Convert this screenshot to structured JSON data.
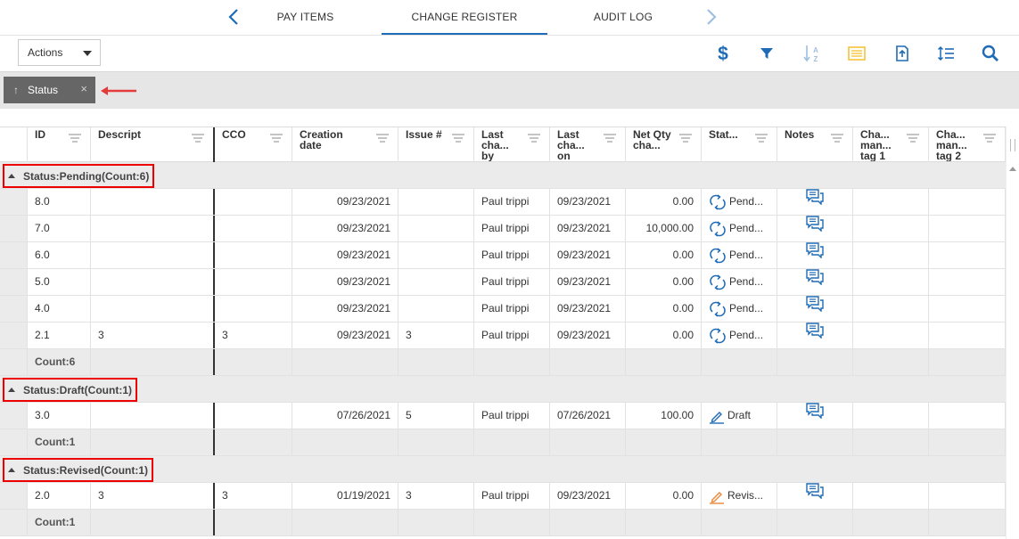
{
  "tabs": {
    "items": [
      {
        "label": "PAY ITEMS"
      },
      {
        "label": "CHANGE REGISTER"
      },
      {
        "label": "AUDIT LOG"
      }
    ],
    "active": "CHANGE REGISTER"
  },
  "toolbar": {
    "actions_label": "Actions",
    "icons": [
      "dollar-icon",
      "filter-icon",
      "sort-az-icon",
      "list-view-icon",
      "export-icon",
      "row-height-icon",
      "search-icon"
    ],
    "accent": "#1f6bb5",
    "highlight": "#f3c12a"
  },
  "group_panel": {
    "chip_label": "Status",
    "chip_direction": "↑",
    "close": "×"
  },
  "columns": [
    {
      "label": "ID"
    },
    {
      "label": "Description"
    },
    {
      "label": "CCO"
    },
    {
      "label": "Creation date"
    },
    {
      "label": "Issue #"
    },
    {
      "label": "Last cha... by"
    },
    {
      "label": "Last cha... on"
    },
    {
      "label": "Net Qty cha..."
    },
    {
      "label": "Stat..."
    },
    {
      "label": "Notes"
    },
    {
      "label": "Cha... man... tag 1"
    },
    {
      "label": "Cha... man... tag 2"
    }
  ],
  "groups": [
    {
      "label": "Status:Pending(Count:6)",
      "rows": [
        {
          "id": "8.0",
          "description": "",
          "cco": "",
          "creation_date": "09/23/2021",
          "issue": "",
          "last_changed_by": "Paul trippi",
          "last_changed_on": "09/23/2021",
          "net_qty": "0.00",
          "status": "Pend...",
          "status_icon": "pending-icon"
        },
        {
          "id": "7.0",
          "description": "",
          "cco": "",
          "creation_date": "09/23/2021",
          "issue": "",
          "last_changed_by": "Paul trippi",
          "last_changed_on": "09/23/2021",
          "net_qty": "10,000.00",
          "status": "Pend...",
          "status_icon": "pending-icon"
        },
        {
          "id": "6.0",
          "description": "",
          "cco": "",
          "creation_date": "09/23/2021",
          "issue": "",
          "last_changed_by": "Paul trippi",
          "last_changed_on": "09/23/2021",
          "net_qty": "0.00",
          "status": "Pend...",
          "status_icon": "pending-icon"
        },
        {
          "id": "5.0",
          "description": "",
          "cco": "",
          "creation_date": "09/23/2021",
          "issue": "",
          "last_changed_by": "Paul trippi",
          "last_changed_on": "09/23/2021",
          "net_qty": "0.00",
          "status": "Pend...",
          "status_icon": "pending-icon"
        },
        {
          "id": "4.0",
          "description": "",
          "cco": "",
          "creation_date": "09/23/2021",
          "issue": "",
          "last_changed_by": "Paul trippi",
          "last_changed_on": "09/23/2021",
          "net_qty": "0.00",
          "status": "Pend...",
          "status_icon": "pending-icon"
        },
        {
          "id": "2.1",
          "description": "3",
          "cco": "3",
          "creation_date": "09/23/2021",
          "issue": "3",
          "last_changed_by": "Paul trippi",
          "last_changed_on": "09/23/2021",
          "net_qty": "0.00",
          "status": "Pend...",
          "status_icon": "pending-icon"
        }
      ],
      "count_label": "Count:6"
    },
    {
      "label": "Status:Draft(Count:1)",
      "rows": [
        {
          "id": "3.0",
          "description": "",
          "cco": "",
          "creation_date": "07/26/2021",
          "issue": "5",
          "last_changed_by": "Paul trippi",
          "last_changed_on": "07/26/2021",
          "net_qty": "100.00",
          "status": "Draft",
          "status_icon": "draft-pencil-icon"
        }
      ],
      "count_label": "Count:1"
    },
    {
      "label": "Status:Revised(Count:1)",
      "rows": [
        {
          "id": "2.0",
          "description": "3",
          "cco": "3",
          "creation_date": "01/19/2021",
          "issue": "3",
          "last_changed_by": "Paul trippi",
          "last_changed_on": "09/23/2021",
          "net_qty": "0.00",
          "status": "Revis...",
          "status_icon": "revised-pencil-icon"
        }
      ],
      "count_label": "Count:1"
    }
  ]
}
